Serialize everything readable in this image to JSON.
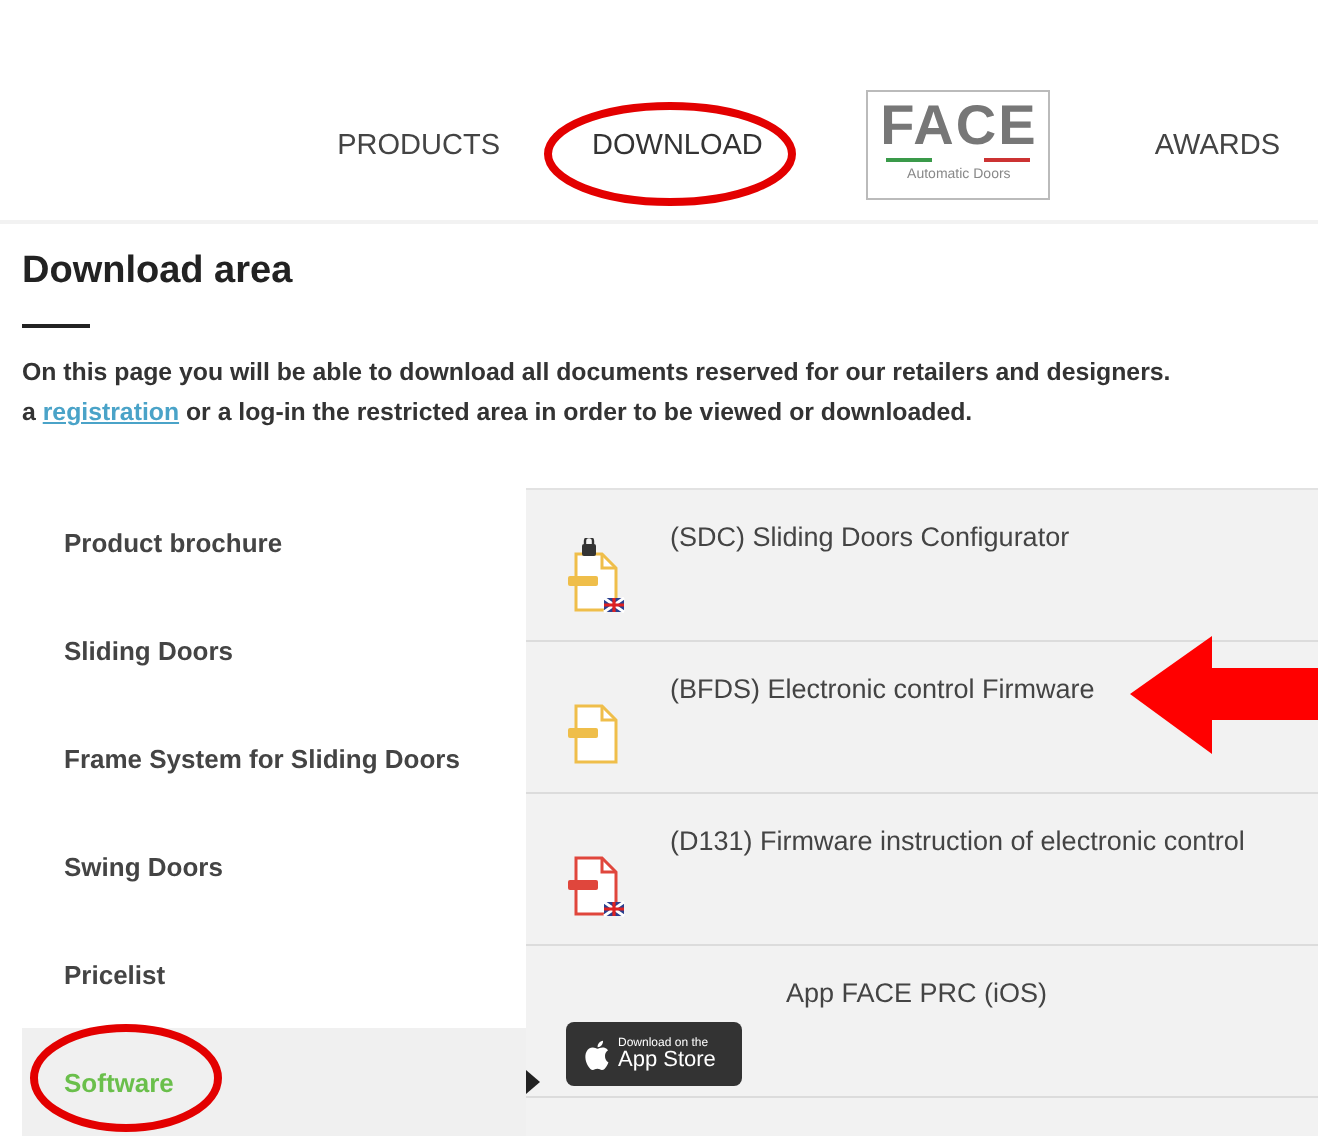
{
  "nav": {
    "items": [
      {
        "label": "PRODUCTS",
        "selected": false
      },
      {
        "label": "DOWNLOAD",
        "selected": true
      }
    ],
    "logo": {
      "name": "FACE",
      "tagline": "Automatic Doors"
    },
    "items_after_logo": [
      {
        "label": "AWARDS",
        "selected": false
      }
    ]
  },
  "page": {
    "title": "Download area",
    "intro_line_1": "On this page you will be able to download all documents reserved for our retailers and designers.",
    "intro_line_2_prefix": "a",
    "intro_link": "registration",
    "intro_line_2_suffix": "or a log-in the restricted area in order to be viewed or downloaded."
  },
  "sidebar": {
    "items": [
      {
        "label": "Product brochure",
        "selected": false
      },
      {
        "label": "Sliding Doors",
        "selected": false
      },
      {
        "label": "Frame System for Sliding Doors",
        "selected": false
      },
      {
        "label": "Swing Doors",
        "selected": false
      },
      {
        "label": "Pricelist",
        "selected": false
      },
      {
        "label": "Software",
        "selected": true
      }
    ]
  },
  "downloads": [
    {
      "kind": "zip",
      "locked": true,
      "english": true,
      "title": "(SDC) Sliding Doors Configurator"
    },
    {
      "kind": "zip",
      "locked": false,
      "english": false,
      "title": "(BFDS) Electronic control Firmware"
    },
    {
      "kind": "pdf",
      "locked": false,
      "english": true,
      "title": "(D131) Firmware instruction of electronic control"
    },
    {
      "kind": "app-store",
      "badge_small": "Download on the",
      "badge_large": "App Store",
      "title": "App FACE PRC (iOS)"
    }
  ]
}
